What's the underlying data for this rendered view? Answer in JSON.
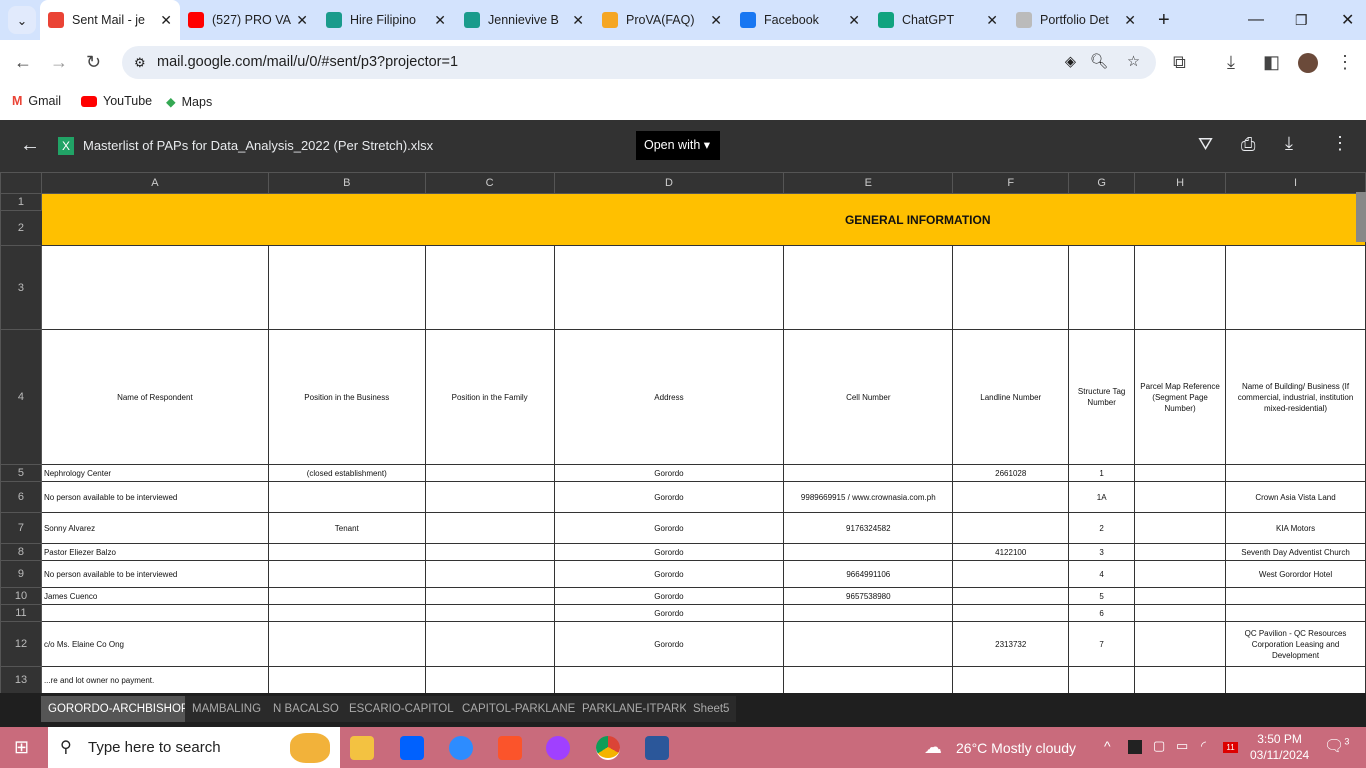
{
  "browser": {
    "tabs": [
      {
        "title": "Sent Mail - je",
        "icon": "gmail-icon",
        "color": "#ea4335",
        "active": true
      },
      {
        "title": "(527) PRO VA",
        "icon": "youtube-icon",
        "color": "#ff0000"
      },
      {
        "title": "Hire Filipino",
        "icon": "pen-icon",
        "color": "#1a9b8c"
      },
      {
        "title": "Jennievive B",
        "icon": "pen-icon",
        "color": "#1a9b8c"
      },
      {
        "title": "ProVA(FAQ)",
        "icon": "va-icon",
        "color": "#f5a623"
      },
      {
        "title": "Facebook",
        "icon": "facebook-icon",
        "color": "#1877f2"
      },
      {
        "title": "ChatGPT",
        "icon": "chatgpt-icon",
        "color": "#10a37f"
      },
      {
        "title": "Portfolio Det",
        "icon": "portfolio-icon",
        "color": "#bbbbbb"
      }
    ],
    "url": "mail.google.com/mail/u/0/#sent/p3?projector=1",
    "bookmarks": [
      "Gmail",
      "YouTube",
      "Maps"
    ]
  },
  "viewer": {
    "filename": "Masterlist of PAPs for Data_Analysis_2022 (Per Stretch).xlsx",
    "file_icon": "X",
    "open_with": "Open with"
  },
  "sheet": {
    "columns": [
      "A",
      "B",
      "C",
      "D",
      "E",
      "F",
      "G",
      "H",
      "I"
    ],
    "title": "GENERAL INFORMATION",
    "headers": [
      "Name of Respondent",
      "Position in the Business",
      "Position in the Family",
      "Address",
      "Cell Number",
      "Landline Number",
      "Structure Tag Number",
      "Parcel Map Reference (Segment Page Number)",
      "Name of Building/ Business (If commercial, industrial, institution mixed-residential)"
    ],
    "rows": [
      {
        "n": "5",
        "c": [
          "Nephrology Center",
          "(closed establishment)",
          "",
          "Gorordo",
          "",
          "2661028",
          "1",
          "",
          ""
        ]
      },
      {
        "n": "6",
        "c": [
          "No person available to be interviewed",
          "",
          "",
          "Gorordo",
          "9989669915 / www.crownasia.com.ph",
          "",
          "1A",
          "",
          "Crown Asia Vista Land"
        ]
      },
      {
        "n": "7",
        "c": [
          "Sonny Alvarez",
          "Tenant",
          "",
          "Gorordo",
          "9176324582",
          "",
          "2",
          "",
          "KIA Motors"
        ]
      },
      {
        "n": "8",
        "c": [
          "Pastor Eliezer Balzo",
          "",
          "",
          "Gorordo",
          "",
          "4122100",
          "3",
          "",
          "Seventh Day Adventist Church"
        ]
      },
      {
        "n": "9",
        "c": [
          "No person available to be interviewed",
          "",
          "",
          "Gorordo",
          "9664991106",
          "",
          "4",
          "",
          "West Gorordor Hotel"
        ]
      },
      {
        "n": "10",
        "c": [
          "James Cuenco",
          "",
          "",
          "Gorordo",
          "9657538980",
          "",
          "5",
          "",
          ""
        ]
      },
      {
        "n": "11",
        "c": [
          "",
          "",
          "",
          "Gorordo",
          "",
          "",
          "6",
          "",
          ""
        ]
      },
      {
        "n": "12",
        "c": [
          "c/o Ms. Elaine Co Ong",
          "",
          "",
          "Gorordo",
          "",
          "2313732",
          "7",
          "",
          "QC Pavilion - QC Resources Corporation Leasing and Development"
        ]
      },
      {
        "n": "13",
        "c": [
          "...re and lot owner no payment.",
          "",
          "",
          "",
          "",
          "",
          "",
          "",
          ""
        ]
      }
    ]
  },
  "sheet_tabs": [
    "GORORDO-ARCHBISHOP",
    "MAMBALING",
    "N BACALSO",
    "ESCARIO-CAPITOL",
    "CAPITOL-PARKLANE",
    "PARKLANE-ITPARK",
    "Sheet5"
  ],
  "taskbar": {
    "search_placeholder": "Type here to search",
    "weather": "26°C  Mostly cloudy",
    "time": "3:50 PM",
    "date": "03/11/2024",
    "notifications": "3",
    "calendar_badge": "11"
  }
}
